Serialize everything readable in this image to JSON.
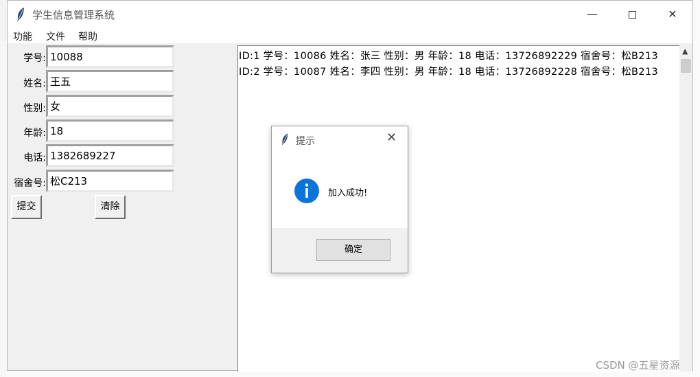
{
  "window": {
    "title": "学生信息管理系统",
    "min_glyph": "—",
    "close_glyph": "✕"
  },
  "menu": [
    "功能",
    "文件",
    "帮助"
  ],
  "form": {
    "fields": [
      {
        "label": "学号:",
        "value": "10088"
      },
      {
        "label": "姓名:",
        "value": "王五"
      },
      {
        "label": "性别:",
        "value": "女"
      },
      {
        "label": "年龄:",
        "value": "18"
      },
      {
        "label": "电话:",
        "value": "1382689227"
      },
      {
        "label": "宿舍号:",
        "value": "松C213"
      }
    ],
    "submit_label": "提交",
    "clear_label": "清除"
  },
  "list": {
    "rows": [
      "ID:1  学号：10086  姓名：张三  性别：男  年龄：18  电话：13726892229  宿舍号：松B213",
      "ID:2  学号：10087  姓名：李四  性别：男  年龄：18  电话：13726892228  宿舍号：松B213"
    ]
  },
  "dialog": {
    "title": "提示",
    "message": "加入成功!",
    "ok_label": "确定",
    "icon": "info-icon",
    "icon_color": "#0a74da"
  },
  "watermark": "CSDN @五星资源"
}
